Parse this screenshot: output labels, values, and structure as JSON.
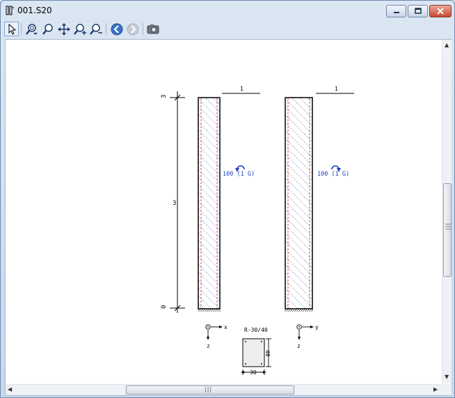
{
  "window": {
    "title": "001.S20",
    "app_icon": "column-icon"
  },
  "toolbar": {
    "items": [
      {
        "name": "select-pointer",
        "icon": "cursor-arrow-icon",
        "active": true
      },
      {
        "name": "zoom-window",
        "icon": "zoom-window-icon"
      },
      {
        "name": "zoom",
        "icon": "magnifier-icon"
      },
      {
        "name": "pan",
        "icon": "move-arrows-icon"
      },
      {
        "name": "zoom-in",
        "icon": "zoom-in-icon"
      },
      {
        "name": "zoom-out",
        "icon": "zoom-out-icon"
      },
      {
        "name": "back",
        "icon": "back-arrow-icon"
      },
      {
        "name": "forward",
        "icon": "forward-arrow-icon",
        "disabled": true
      },
      {
        "name": "camera",
        "icon": "camera-icon"
      }
    ]
  },
  "drawing": {
    "level_top": "3",
    "level_mid": "3",
    "level_bottom": "0",
    "column_left": {
      "top_label": "1",
      "moment_label": "100 (1 G)"
    },
    "column_right": {
      "top_label": "1",
      "moment_label": "100 (1 G)"
    },
    "axis_left": {
      "horizontal": "x",
      "vertical": "z"
    },
    "axis_right": {
      "horizontal": "y",
      "vertical": "z"
    },
    "section": {
      "name": "R-30/40",
      "width": "30",
      "height": "40"
    },
    "colors": {
      "line": "#000000",
      "hatch": "#1f3fbf",
      "rebar": "#cc2222",
      "moment": "#1f3fbf"
    }
  },
  "scrollbars": {
    "grip": "|||"
  }
}
